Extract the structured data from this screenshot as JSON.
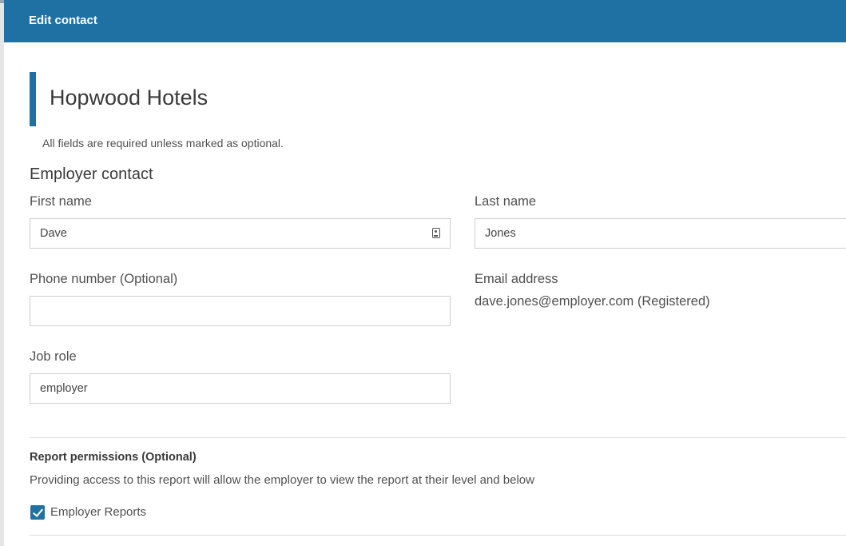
{
  "dialog": {
    "title": "Edit contact"
  },
  "organisation": {
    "name": "Hopwood Hotels"
  },
  "form": {
    "required_note": "All fields are required unless marked as optional.",
    "section_title": "Employer contact",
    "first_name": {
      "label": "First name",
      "value": "Dave"
    },
    "last_name": {
      "label": "Last name",
      "value": "Jones"
    },
    "phone": {
      "label": "Phone number (Optional)",
      "value": ""
    },
    "email": {
      "label": "Email address",
      "value": "dave.jones@employer.com (Registered)"
    },
    "job_role": {
      "label": "Job role",
      "value": "employer"
    }
  },
  "permissions": {
    "title": "Report permissions (Optional)",
    "description": "Providing access to this report will allow the employer to view the report at their level and below",
    "options": [
      {
        "label": "Employer Reports",
        "checked": true
      }
    ]
  },
  "icons": {
    "first_name_field_icon": "contact-card-icon",
    "checkbox_mark": "checkmark-icon"
  },
  "colors": {
    "accent": "#1f70a3"
  }
}
